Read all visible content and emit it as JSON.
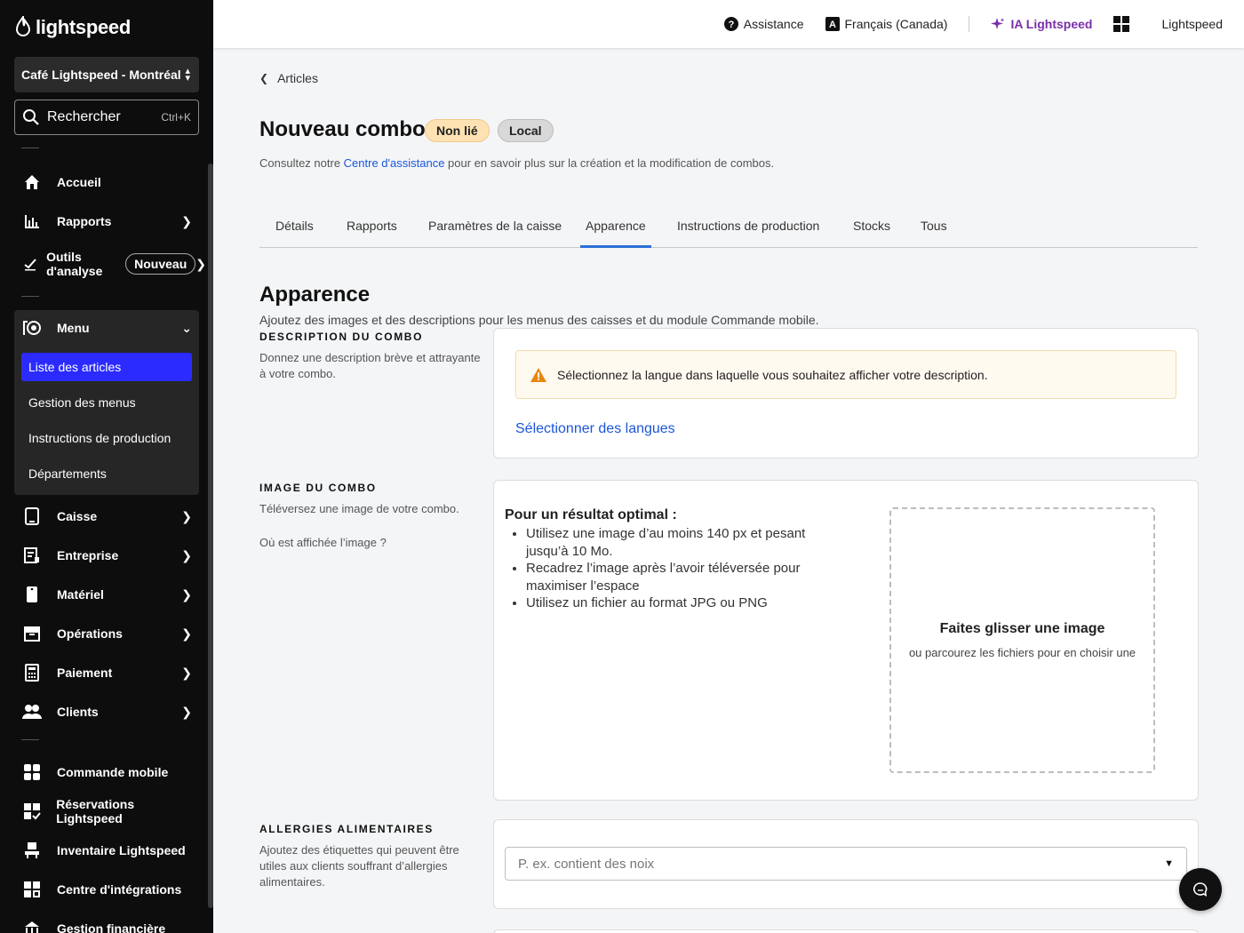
{
  "sidebar": {
    "logo_text": "lightspeed",
    "store": "Café Lightspeed - Montréal",
    "search": {
      "label": "Rechercher",
      "shortcut": "Ctrl+K"
    },
    "items": [
      {
        "label": "Accueil",
        "icon": "home-icon"
      },
      {
        "label": "Rapports",
        "icon": "bar-chart-icon"
      },
      {
        "label": "Outils d'analyse",
        "icon": "analytics-icon",
        "badge": "Nouveau"
      },
      {
        "label": "Menu",
        "icon": "menu-icon"
      },
      {
        "label": "Caisse",
        "icon": "tablet-icon"
      },
      {
        "label": "Entreprise",
        "icon": "business-icon"
      },
      {
        "label": "Matériel",
        "icon": "hardware-icon"
      },
      {
        "label": "Opérations",
        "icon": "archive-icon"
      },
      {
        "label": "Paiement",
        "icon": "calculator-icon"
      },
      {
        "label": "Clients",
        "icon": "clients-icon"
      },
      {
        "label": "Commande mobile",
        "icon": "mobile-order-icon"
      },
      {
        "label": "Réservations Lightspeed",
        "icon": "reservations-icon"
      },
      {
        "label": "Inventaire Lightspeed",
        "icon": "inventory-icon"
      },
      {
        "label": "Centre d'intégrations",
        "icon": "integrations-icon"
      },
      {
        "label": "Gestion financière",
        "icon": "finance-icon"
      }
    ],
    "menu_sub": [
      {
        "label": "Liste des articles",
        "active": true
      },
      {
        "label": "Gestion des menus"
      },
      {
        "label": "Instructions de production"
      },
      {
        "label": "Départements"
      }
    ]
  },
  "topbar": {
    "assistance": "Assistance",
    "language": "Français (Canada)",
    "ai": "IA Lightspeed",
    "account": "Lightspeed"
  },
  "page": {
    "breadcrumb": "Articles",
    "title": "Nouveau combo",
    "badges": {
      "unlinked": "Non lié",
      "local": "Local"
    },
    "help_prefix": "Consultez notre ",
    "help_link": "Centre d'assistance",
    "help_suffix": " pour en savoir plus sur la création et la modification de combos.",
    "tabs": [
      "Détails",
      "Rapports",
      "Paramètres de la caisse",
      "Apparence",
      "Instructions de production",
      "Stocks",
      "Tous"
    ],
    "active_tab": "Apparence",
    "section_title": "Apparence",
    "section_sub": "Ajoutez des images et des descriptions pour les menus des caisses et du module Commande mobile."
  },
  "description": {
    "heading": "DESCRIPTION DU COMBO",
    "text": "Donnez une description brève et attrayante à votre combo.",
    "warning": "Sélectionnez la langue dans laquelle vous souhaitez afficher votre description.",
    "select_languages": "Sélectionner des langues"
  },
  "image": {
    "heading": "IMAGE DU COMBO",
    "text": "Téléversez une image de votre combo.",
    "where_link": "Où est affichée l’image ?",
    "tips_title": "Pour un résultat optimal :",
    "tips": [
      "Utilisez une image d’au moins 140 px et pesant jusqu’à 10 Mo.",
      "Recadrez l’image après l’avoir téléversée pour maximiser l’espace",
      "Utilisez un fichier au format JPG ou PNG"
    ],
    "drop_title": "Faites glisser une image",
    "drop_sub": "ou parcourez les fichiers pour en choisir une"
  },
  "allergies": {
    "heading": "ALLERGIES ALIMENTAIRES",
    "text": "Ajoutez des étiquettes qui peuvent être utiles aux clients souffrant d’allergies alimentaires.",
    "placeholder": "P. ex. contient des noix"
  }
}
